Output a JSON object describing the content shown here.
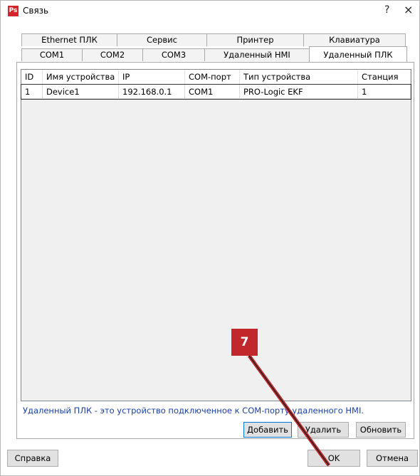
{
  "window": {
    "title": "Связь",
    "app_icon": "Ps",
    "help": "?",
    "close": "×"
  },
  "tabs_row1": [
    "Ethernet ПЛК",
    "Сервис",
    "Принтер",
    "Клавиатура"
  ],
  "tabs_row2": [
    "COM1",
    "COM2",
    "COM3",
    "Удаленный HMI",
    "Удаленный ПЛК"
  ],
  "active_tab": "Удаленный ПЛК",
  "table": {
    "columns": [
      "ID",
      "Имя устройства",
      "IP",
      "COM-порт",
      "Тип устройства",
      "Станция"
    ],
    "rows": [
      [
        "1",
        "Device1",
        "192.168.0.1",
        "COM1",
        "PRO-Logic EKF",
        "1"
      ]
    ]
  },
  "info_text": "Удаленный ПЛК - это устройство подключенное к COM-порту удаленного HMI.",
  "buttons": {
    "add": "Добавить",
    "delete": "Удалить",
    "refresh": "Обновить",
    "help": "Справка",
    "ok": "OK",
    "cancel": "Отмена"
  },
  "annotation": {
    "label": "7",
    "color": "#c0282b"
  }
}
